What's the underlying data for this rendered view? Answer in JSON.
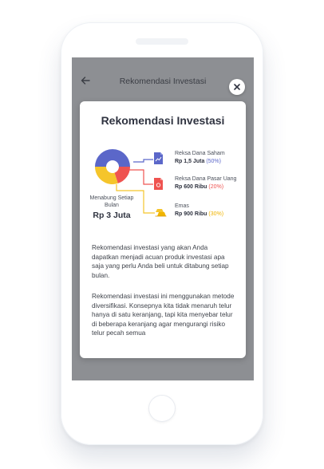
{
  "appbar": {
    "title": "Rekomendasi Investasi"
  },
  "modal": {
    "title": "Rekomendasi Investasi",
    "monthly_label": "Menabung Setiap Bulan",
    "monthly_amount": "Rp 3 Juta",
    "chart_data": {
      "type": "pie",
      "categories": [
        "Reksa Dana Saham",
        "Reksa Dana Pasar Uang",
        "Emas"
      ],
      "values": [
        50,
        20,
        30
      ],
      "colors": [
        "#5b67c9",
        "#ef5350",
        "#f5c52b"
      ]
    },
    "items": [
      {
        "name": "Reksa Dana Saham",
        "amount": "Rp 1,5 Juta",
        "percent": "(50%)",
        "color": "#5b67c9",
        "icon": "document-chart-icon"
      },
      {
        "name": "Reksa Dana Pasar Uang",
        "amount": "Rp 600 Ribu",
        "percent": "(20%)",
        "color": "#ef5350",
        "icon": "document-money-icon"
      },
      {
        "name": "Emas",
        "amount": "Rp 900 Ribu",
        "percent": "(30%)",
        "color": "#f5c52b",
        "icon": "gold-bar-icon"
      }
    ],
    "paragraph_1": "Rekomendasi investasi yang akan Anda dapatkan menjadi acuan produk investasi apa saja yang perlu Anda beli untuk ditabung setiap bulan.",
    "paragraph_2": "Rekomendasi investasi ini menggunakan metode diversifikasi. Konsepnya kita tidak menaruh telur hanya di satu keranjang, tapi kita menyebar telur di beberapa keranjang agar mengurangi risiko telur pecah semua"
  }
}
